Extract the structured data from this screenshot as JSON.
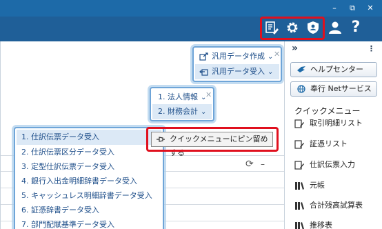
{
  "window": {
    "minimize": "–",
    "restore": "⧉",
    "close": "✕"
  },
  "toolbar": {
    "icons": [
      "menu-edit-icon",
      "gear-icon",
      "shield-user-icon",
      "user-icon",
      "help-icon"
    ],
    "help_label": "?"
  },
  "right_panel": {
    "collapse": "»",
    "menu": "⋮",
    "help_center": "ヘルプセンター",
    "net_service": "奉行 Netサービス",
    "quick_menu_title": "クイックメニュー",
    "items": [
      "取引明細リスト",
      "証憑リスト",
      "仕訳伝票入力",
      "元帳",
      "合計残高試算表",
      "推移表"
    ]
  },
  "popup_top": {
    "items": [
      "汎用データ作成",
      "汎用データ受入"
    ],
    "close": "✕"
  },
  "popup_mid": {
    "items": [
      "1. 法人情報",
      "2. 財務会計"
    ],
    "close": "✕"
  },
  "popup_list": {
    "items": [
      "1. 仕訳伝票データ受入",
      "2. 仕訳伝票区分データ受入",
      "3. 定型仕訳伝票データ受入",
      "4. 銀行入出金明細辞書データ受入",
      "5. キャッシュレス明細辞書データ受入",
      "6. 証憑辞書データ受入",
      "7. 部門配賦基準データ受入"
    ]
  },
  "tooltip": {
    "text": "クイックメニューにピン留めする"
  },
  "main_tools": {
    "refresh": "⟳",
    "minimize": "–"
  },
  "colors": {
    "title_bar": "#1f5f98",
    "highlight": "#e0101e",
    "popup_border": "#6fa5d8",
    "selected_row": "#dce9f6",
    "link_text": "#1f4f8a"
  }
}
